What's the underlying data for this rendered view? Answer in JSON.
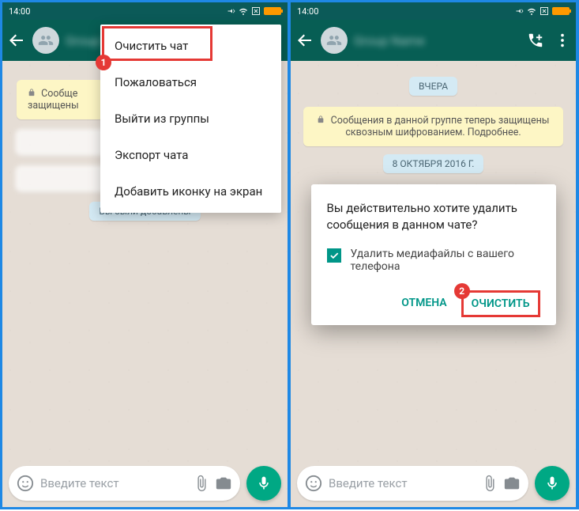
{
  "statusbar": {
    "time": "14:00"
  },
  "left": {
    "yellow": "Сообще защищены",
    "menu": {
      "clear": "Очистить чат",
      "report": "Пожаловаться",
      "leave": "Выйти из группы",
      "export": "Экспорт чата",
      "addicon": "Добавить иконку на экран"
    },
    "added": "Вы были добавлены",
    "input_placeholder": "Введите текст"
  },
  "right": {
    "yesterday": "ВЧЕРА",
    "yellow": "Сообщения в данной группе теперь защищены сквозным шифрованием. Подробнее.",
    "date": "8 ОКТЯБРЯ 2016 Г.",
    "input_placeholder": "Введите текст",
    "dialog": {
      "title": "Вы действительно хотите удалить сообщения в данном чате?",
      "checkbox": "Удалить медиафайлы с вашего телефона",
      "cancel": "ОТМЕНА",
      "confirm": "ОЧИСТИТЬ"
    }
  },
  "markers": {
    "m1": "1"
  }
}
